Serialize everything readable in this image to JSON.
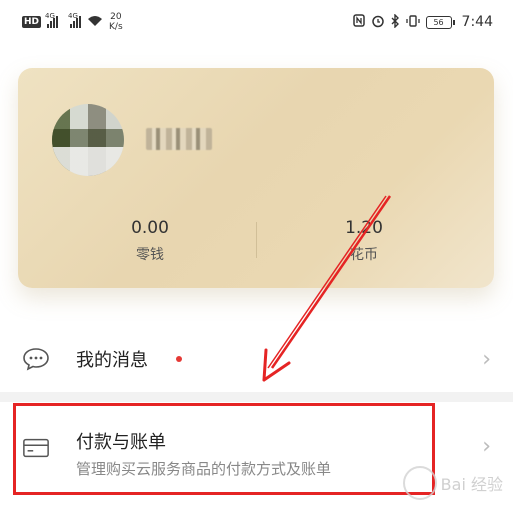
{
  "status_bar": {
    "hd_badge": "HD",
    "signal_1_tag": "4G",
    "signal_2_tag": "4G",
    "net_speed_value": "20",
    "net_speed_unit": "K/s",
    "nfc_icon": "nfc-icon",
    "alarm_icon": "alarm-icon",
    "bluetooth_icon": "bluetooth-icon",
    "vibrate_icon": "vibrate-icon",
    "battery_level": "56",
    "time": "7:44"
  },
  "wallet_card": {
    "username_obscured": true,
    "balance_value": "0.00",
    "balance_label": "零钱",
    "coins_value": "1.20",
    "coins_label": "花币"
  },
  "menu": {
    "messages_label": "我的消息",
    "messages_has_unread": true,
    "billing_label": "付款与账单",
    "billing_subtitle": "管理购买云服务商品的付款方式及账单"
  },
  "watermark": {
    "text": "Bai 经验"
  },
  "colors": {
    "card_gold": "#e8d6b0",
    "annotation_red": "#e52424",
    "unread_dot": "#e53935"
  }
}
